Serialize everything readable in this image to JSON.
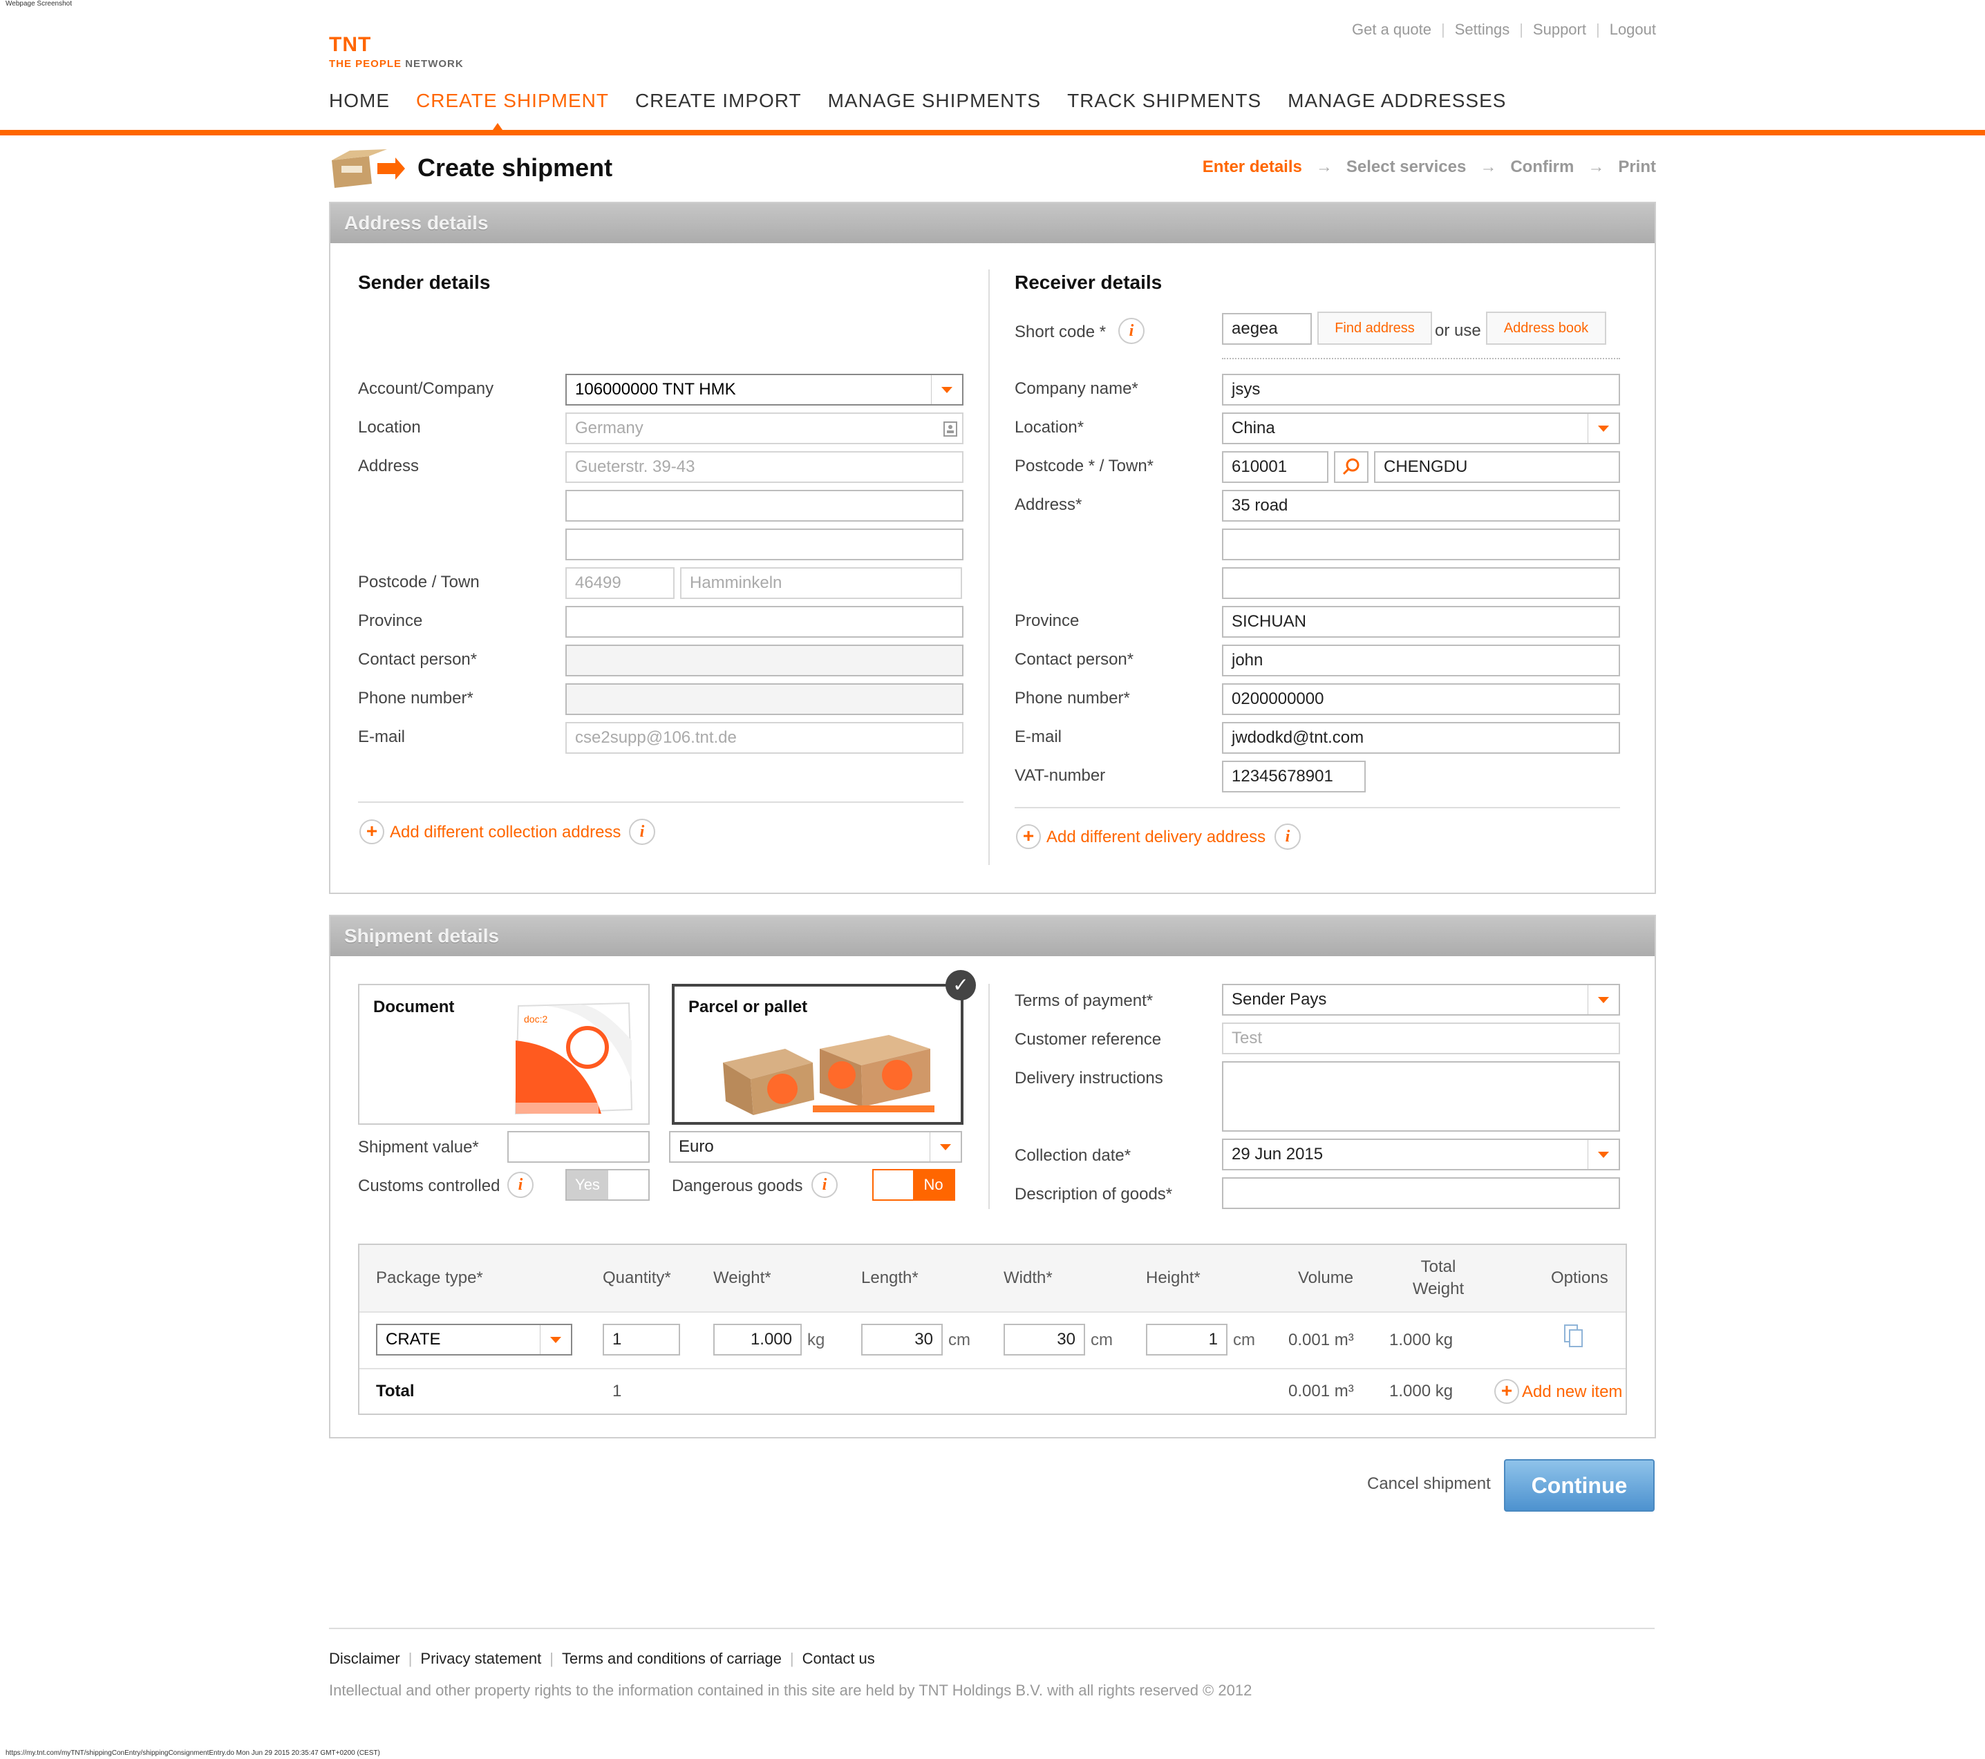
{
  "window": {
    "caption": "Webpage Screenshot",
    "url_footer": "https://my.tnt.com/myTNT/shippingConEntry/shippingConsignmentEntry.do Mon Jun 29 2015 20:35:47 GMT+0200 (CEST)"
  },
  "brand": {
    "mark": "TNT",
    "tagline_a": "THE PEOPLE",
    "tagline_b": " NETWORK",
    "color": "#ff6600"
  },
  "toplinks": [
    "Get a quote",
    "Settings",
    "Support",
    "Logout"
  ],
  "nav": {
    "items": [
      "HOME",
      "CREATE SHIPMENT",
      "CREATE IMPORT",
      "MANAGE SHIPMENTS",
      "TRACK SHIPMENTS",
      "MANAGE ADDRESSES"
    ],
    "active": "CREATE SHIPMENT"
  },
  "page": {
    "title": "Create shipment",
    "steps": [
      "Enter details",
      "Select services",
      "Confirm",
      "Print"
    ],
    "active_step": "Enter details"
  },
  "address": {
    "panel_title": "Address details",
    "sender": {
      "title": "Sender details",
      "labels": {
        "account": "Account/Company",
        "location": "Location",
        "address": "Address",
        "postcode_town": "Postcode / Town",
        "province": "Province",
        "contact": "Contact person*",
        "phone": "Phone number*",
        "email": "E-mail"
      },
      "values": {
        "account": "106000000 TNT HMK",
        "location": "Germany",
        "address1": "Gueterstr. 39-43",
        "address2": "",
        "address3": "",
        "postcode": "46499",
        "town": "Hamminkeln",
        "province": "",
        "contact": "",
        "phone": "",
        "email": "cse2supp@106.tnt.de"
      },
      "add_link": "Add different collection address"
    },
    "receiver": {
      "title": "Receiver details",
      "labels": {
        "short_code": "Short code *",
        "company": "Company name*",
        "location": "Location*",
        "postcode_town": "Postcode * / Town*",
        "address": "Address*",
        "province": "Province",
        "contact": "Contact person*",
        "phone": "Phone number*",
        "email": "E-mail",
        "vat": "VAT-number"
      },
      "values": {
        "short_code": "aegea",
        "company": "jsys",
        "location": "China",
        "postcode": "610001",
        "town": "CHENGDU",
        "address1": "35 road",
        "address2": "",
        "address3": "",
        "province": "SICHUAN",
        "contact": "john",
        "phone": "0200000000",
        "email": "jwdodkd@tnt.com",
        "vat": "12345678901"
      },
      "find_button": "Find address",
      "or_use": "or use",
      "address_book_button": "Address book",
      "add_link": "Add different delivery address"
    }
  },
  "shipment": {
    "panel_title": "Shipment details",
    "types": {
      "document": "Document",
      "parcel": "Parcel or pallet",
      "selected": "Parcel or pallet",
      "document_badge": "doc:2"
    },
    "labels": {
      "shipment_value": "Shipment value*",
      "customs": "Customs controlled",
      "dangerous": "Dangerous goods",
      "terms": "Terms of payment*",
      "customer_ref": "Customer reference",
      "delivery_instr": "Delivery instructions",
      "collection_date": "Collection date*",
      "description": "Description of goods*"
    },
    "values": {
      "shipment_value": "",
      "currency": "Euro",
      "customs_toggle": "Yes",
      "dangerous_toggle": "No",
      "terms": "Sender Pays",
      "customer_ref": "Test",
      "delivery_instr": "",
      "collection_date": "29 Jun 2015",
      "description": ""
    }
  },
  "packages": {
    "headers": {
      "type": "Package type*",
      "quantity": "Quantity*",
      "weight": "Weight*",
      "length": "Length*",
      "width": "Width*",
      "height": "Height*",
      "volume": "Volume",
      "total_weight_1": "Total",
      "total_weight_2": "Weight",
      "options": "Options"
    },
    "row": {
      "type": "CRATE",
      "quantity": "1",
      "weight": "1.000",
      "weight_unit": "kg",
      "length": "30",
      "width": "30",
      "height": "1",
      "dim_unit": "cm",
      "volume": "0.001 m³",
      "total_weight": "1.000 kg"
    },
    "total": {
      "label": "Total",
      "quantity": "1",
      "volume": "0.001 m³",
      "weight": "1.000 kg"
    },
    "add_item": "Add new item"
  },
  "actions": {
    "cancel": "Cancel shipment",
    "continue": "Continue"
  },
  "footer": {
    "links": [
      "Disclaimer",
      "Privacy statement",
      "Terms and conditions of carriage",
      "Contact us"
    ],
    "copyright": "Intellectual and other property rights to the information contained in this site are held by TNT Holdings B.V. with all rights reserved © 2012"
  }
}
